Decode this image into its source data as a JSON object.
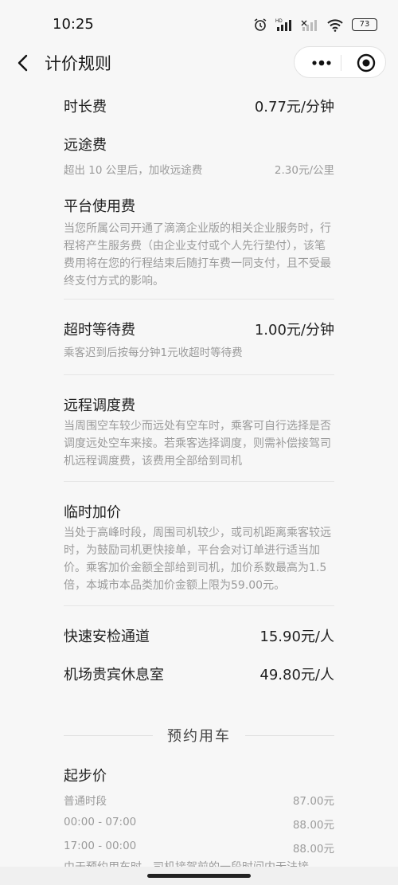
{
  "status": {
    "time": "10:25",
    "battery": "73"
  },
  "nav": {
    "title": "计价规则"
  },
  "fees": {
    "duration": {
      "name": "时长费",
      "price": "0.77元/分钟"
    },
    "longdistance": {
      "name": "远途费",
      "sub_left": "超出 10 公里后，加收远途费",
      "sub_right": "2.30元/公里"
    },
    "platform": {
      "name": "平台使用费",
      "desc": "当您所属公司开通了滴滴企业版的相关企业服务时，行程将产生服务费（由企业支付或个人先行垫付），该笔费用将在您的行程结束后随打车费一同支付，且不受最终支付方式的影响。"
    },
    "overtime": {
      "name": "超时等待费",
      "price": "1.00元/分钟",
      "sub_left": "乘客迟到后按每分钟1元收超时等待费"
    },
    "dispatch": {
      "name": "远程调度费",
      "desc": "当周围空车较少而远处有空车时，乘客可自行选择是否调度远处空车来接。若乘客选择调度，则需补偿接驾司机远程调度费，该费用全部给到司机"
    },
    "surge": {
      "name": "临时加价",
      "desc": "当处于高峰时段，周围司机较少，或司机距离乘客较远时，为鼓励司机更快接单，平台会对订单进行适当加价。乘客加价金额全部给到司机，加价系数最高为1.5倍，本城市本品类加价金额上限为59.00元。"
    },
    "security": {
      "name": "快速安检通道",
      "price": "15.90元/人"
    },
    "lounge": {
      "name": "机场贵宾休息室",
      "price": "49.80元/人"
    }
  },
  "reservation": {
    "section_title": "预约用车",
    "base": {
      "name": "起步价"
    },
    "rows": [
      {
        "label": "普通时段",
        "value": "87.00元"
      },
      {
        "label": "00:00 - 07:00",
        "value": "88.00元"
      },
      {
        "label": "17:00 - 00:00",
        "value": "88.00元"
      }
    ],
    "note": "由于预约用车时，司机接驾前的一段时间内无法接"
  }
}
